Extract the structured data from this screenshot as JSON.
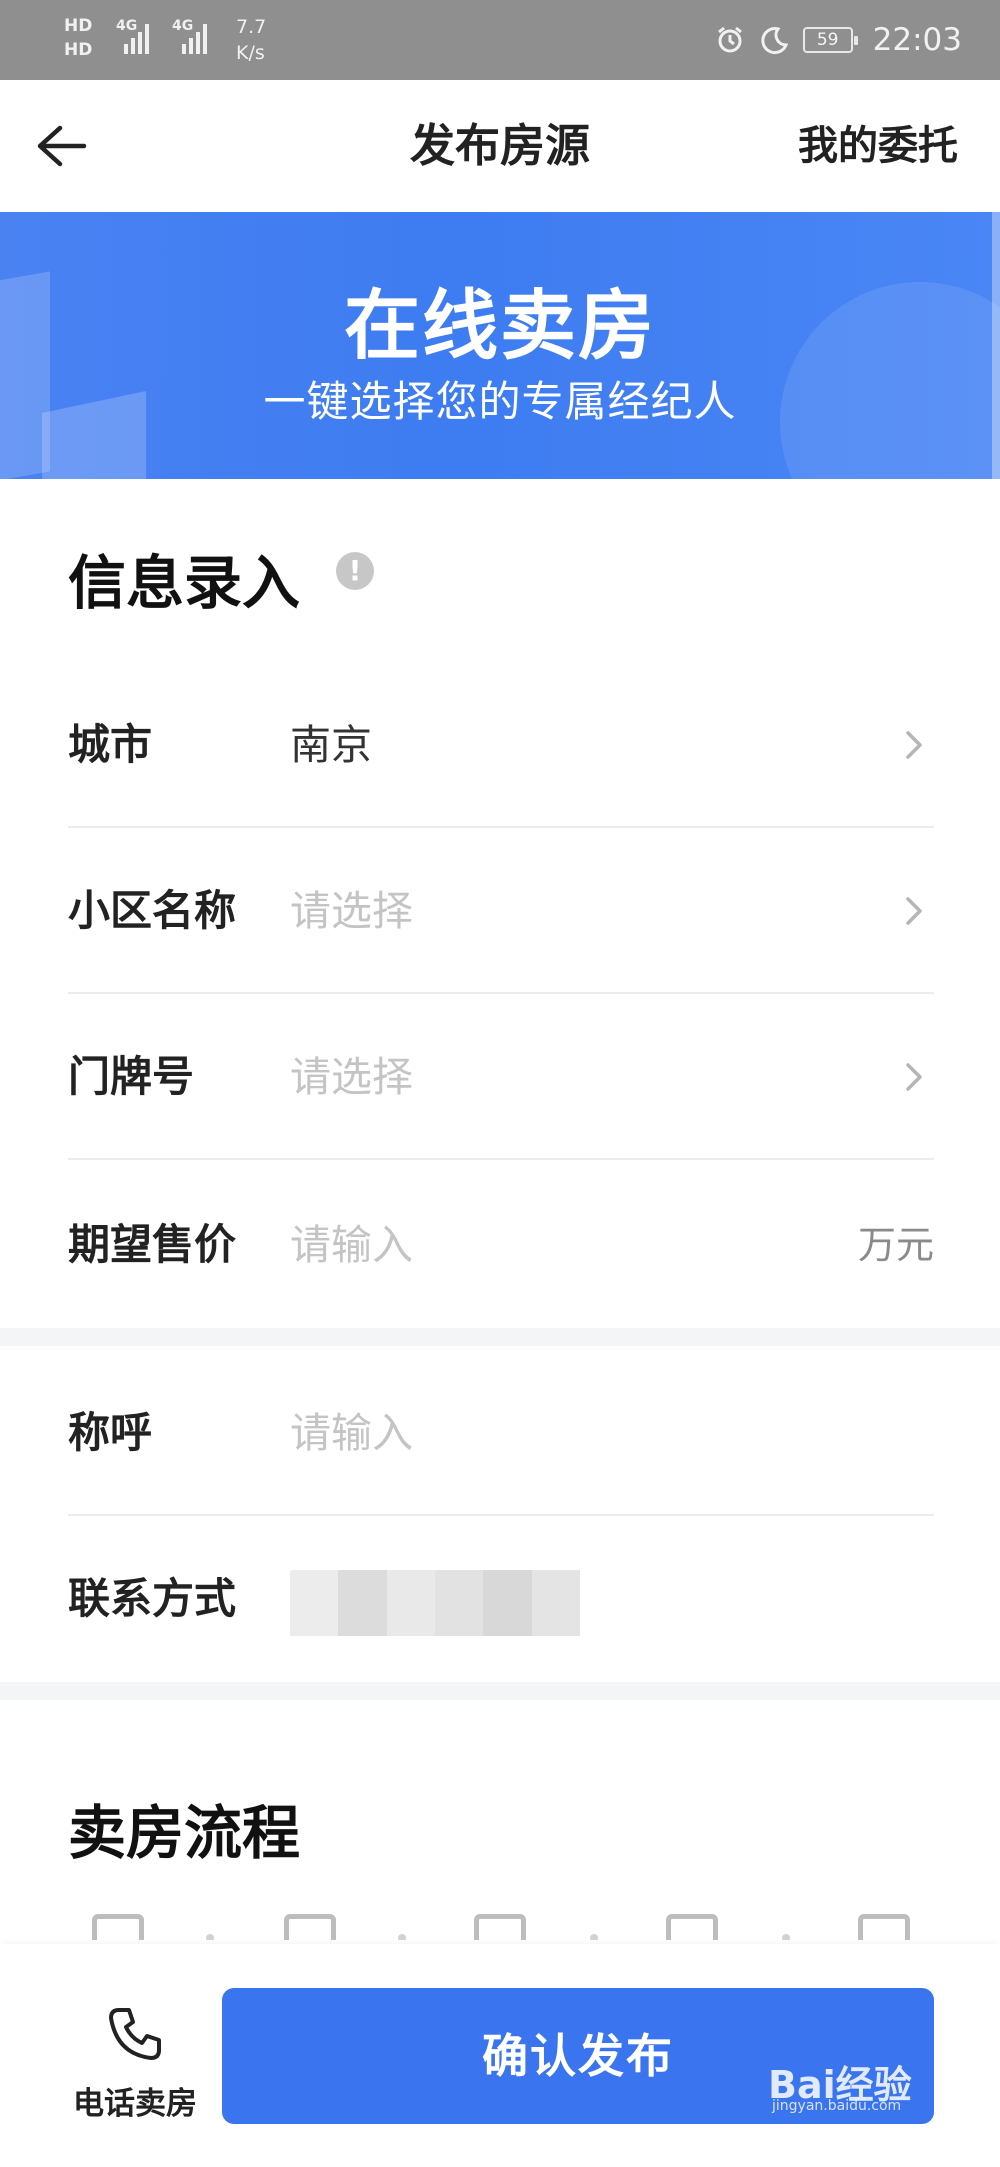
{
  "status_bar": {
    "hd1": "HD",
    "hd2": "HD",
    "net1": "4G",
    "net2": "4G",
    "speed_value": "7.7",
    "speed_unit": "K/s",
    "battery": "59",
    "time": "22:03"
  },
  "nav": {
    "title": "发布房源",
    "right_action": "我的委托"
  },
  "banner": {
    "title": "在线卖房",
    "subtitle": "一键选择您的专属经纪人"
  },
  "form": {
    "section_title": "信息录入",
    "rows": [
      {
        "label": "城市",
        "value": "南京"
      },
      {
        "label": "小区名称",
        "placeholder": "请选择"
      },
      {
        "label": "门牌号",
        "placeholder": "请选择"
      },
      {
        "label": "期望售价",
        "placeholder": "请输入",
        "unit": "万元"
      }
    ],
    "contact_rows": [
      {
        "label": "称呼",
        "placeholder": "请输入"
      },
      {
        "label": "联系方式"
      }
    ]
  },
  "process": {
    "section_title": "卖房流程"
  },
  "bottom": {
    "phone_label": "电话卖房",
    "confirm_label": "确认发布",
    "watermark": "Bai经验",
    "watermark_sub": "jingyan.baidu.com"
  },
  "colors": {
    "primary": "#3a74ef",
    "banner": "#3d7cf1",
    "status_bar": "#8f8f8f"
  }
}
